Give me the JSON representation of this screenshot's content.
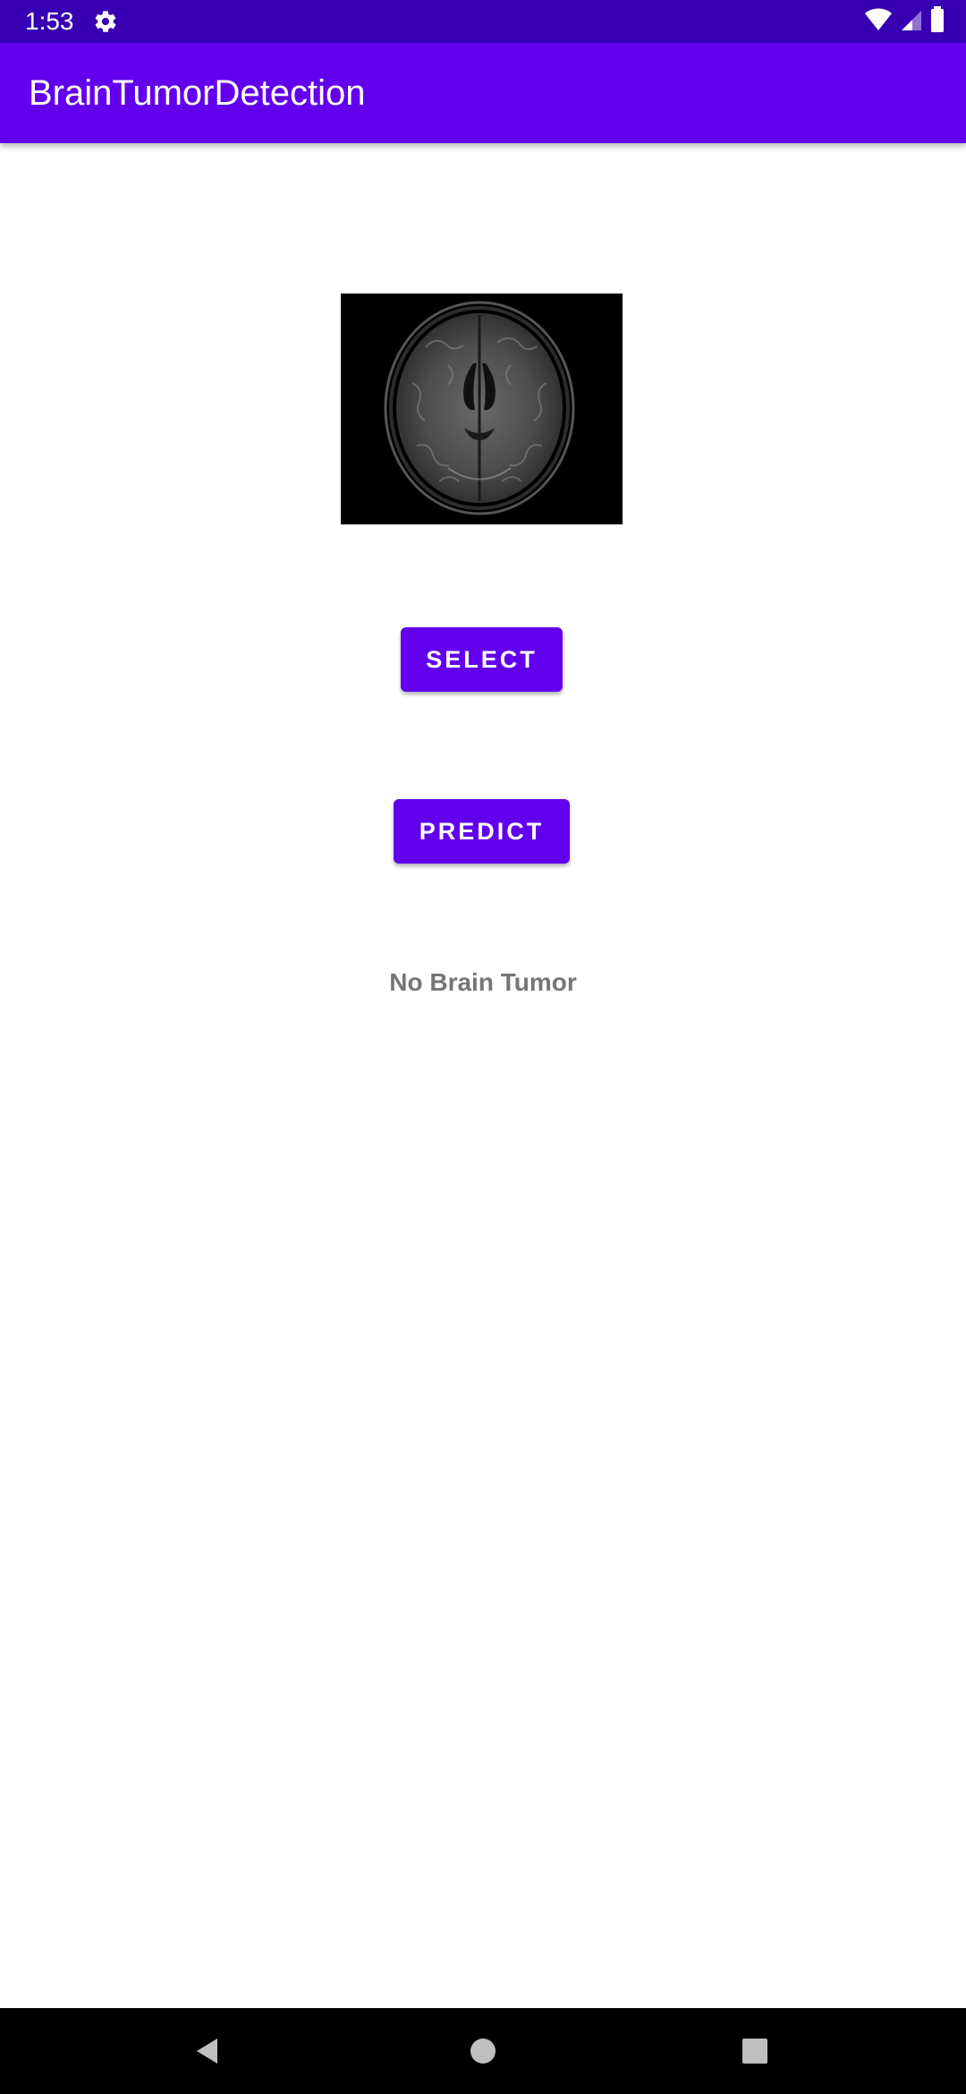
{
  "status_bar": {
    "time": "1:53",
    "icons": [
      "settings-gear-icon",
      "wifi-icon",
      "signal-icon",
      "battery-icon"
    ]
  },
  "app_bar": {
    "title": "BrainTumorDetection"
  },
  "main": {
    "image": {
      "icon": "brain-mri-scan-image"
    },
    "select_button_label": "SELECT",
    "predict_button_label": "PREDICT",
    "result_text": "No Brain Tumor"
  },
  "nav_bar": {
    "icons": [
      "back-icon",
      "home-icon",
      "recents-icon"
    ]
  },
  "colors": {
    "status_bar": "#3700b3",
    "app_bar": "#6200ee",
    "button": "#6200ee",
    "result_text": "#757575"
  }
}
